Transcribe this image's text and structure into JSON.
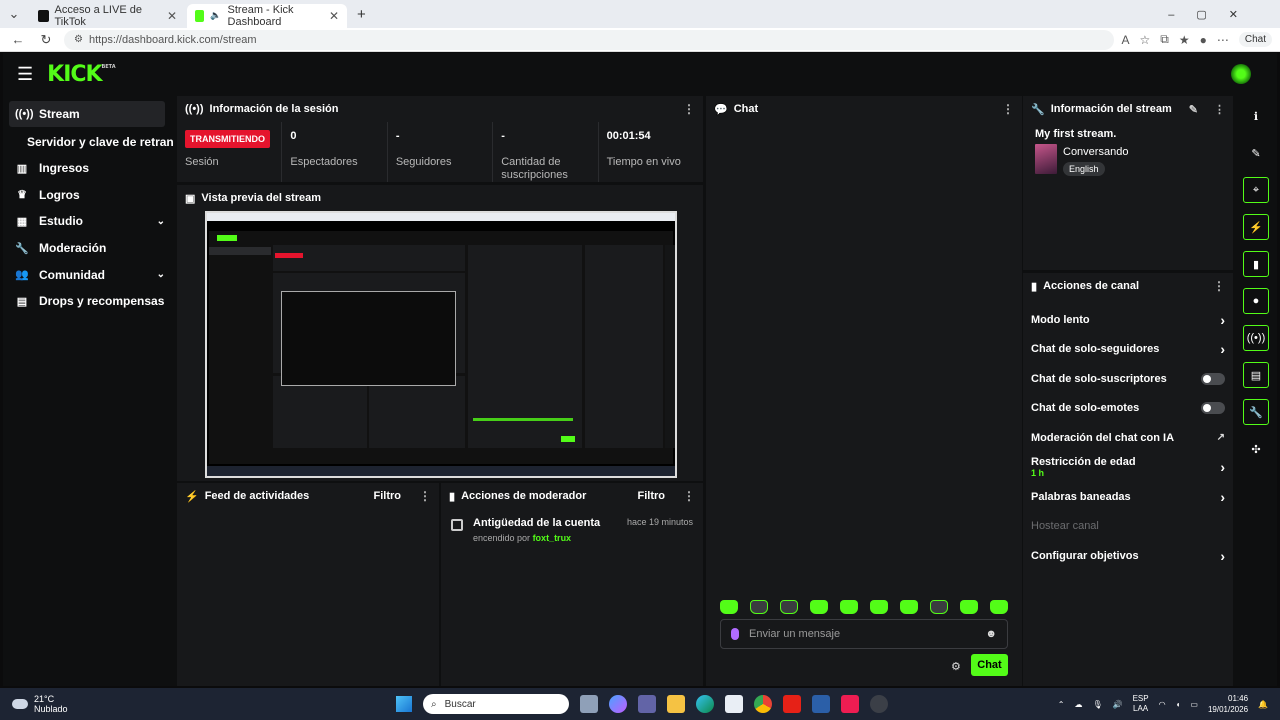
{
  "browser": {
    "tabs": [
      {
        "label": "Acceso a LIVE de TikTok",
        "active": false
      },
      {
        "label": "Stream - Kick Dashboard",
        "active": true
      }
    ],
    "new_tab": "+",
    "url": "https://dashboard.kick.com/stream",
    "copilot_label": "Chat"
  },
  "app": {
    "logo": "KICK",
    "logo_badge": "BETA",
    "brand_color": "#53fc18",
    "live_color": "#e5142d"
  },
  "sidebar": {
    "items": [
      {
        "label": "Stream",
        "icon": "broadcast-icon"
      },
      {
        "label": "Servidor y clave de retransm"
      },
      {
        "label": "Ingresos",
        "icon": "chart-icon"
      },
      {
        "label": "Logros",
        "icon": "trophy-icon"
      },
      {
        "label": "Estudio",
        "icon": "grid-icon"
      },
      {
        "label": "Moderación",
        "icon": "wrench-icon"
      },
      {
        "label": "Comunidad",
        "icon": "users-icon"
      },
      {
        "label": "Drops y recompensas",
        "icon": "gift-icon"
      }
    ]
  },
  "session": {
    "title": "Información de la sesión",
    "status_badge": "TRANSMITIENDO",
    "status_label": "Sesión",
    "stats": [
      {
        "value": "0",
        "label": "Espectadores"
      },
      {
        "value": "-",
        "label": "Seguidores"
      },
      {
        "value": "-",
        "label": "Cantidad de suscripciones"
      },
      {
        "value": "00:01:54",
        "label": "Tiempo en vivo"
      }
    ]
  },
  "preview": {
    "title": "Vista previa del stream"
  },
  "feed": {
    "title": "Feed de actividades",
    "filter": "Filtro"
  },
  "moderator": {
    "title": "Acciones de moderador",
    "filter": "Filtro",
    "entries": [
      {
        "title": "Antigüedad de la cuenta",
        "prefix": "encendido por",
        "user": "foxt_trux",
        "time": "hace 19 minutos"
      }
    ]
  },
  "chat": {
    "title": "Chat",
    "placeholder": "Enviar un mensaje",
    "send_label": "Chat"
  },
  "stream_info": {
    "title": "Información del stream",
    "stream_title": "My first stream.",
    "category": "Conversando",
    "language": "English"
  },
  "channel_actions": {
    "title": "Acciones de canal",
    "items": [
      {
        "label": "Modo lento",
        "control": "arrow"
      },
      {
        "label": "Chat de solo-seguidores",
        "control": "arrow"
      },
      {
        "label": "Chat de solo-suscriptores",
        "control": "toggle",
        "on": false
      },
      {
        "label": "Chat de solo-emotes",
        "control": "toggle",
        "on": false
      },
      {
        "label": "Moderación del chat con IA",
        "control": "external"
      },
      {
        "label": "Restricción de edad",
        "sub": "1 h",
        "control": "arrow"
      },
      {
        "label": "Palabras baneadas",
        "control": "arrow"
      },
      {
        "label": "Hostear canal",
        "control": "none",
        "disabled": true
      },
      {
        "label": "Configurar objetivos",
        "control": "arrow"
      }
    ]
  },
  "taskbar": {
    "temp": "21°C",
    "weather": "Nublado",
    "search": "Buscar",
    "lang": "ESP",
    "lang2": "LAA",
    "time": "01:46",
    "date": "19/01/2026"
  }
}
